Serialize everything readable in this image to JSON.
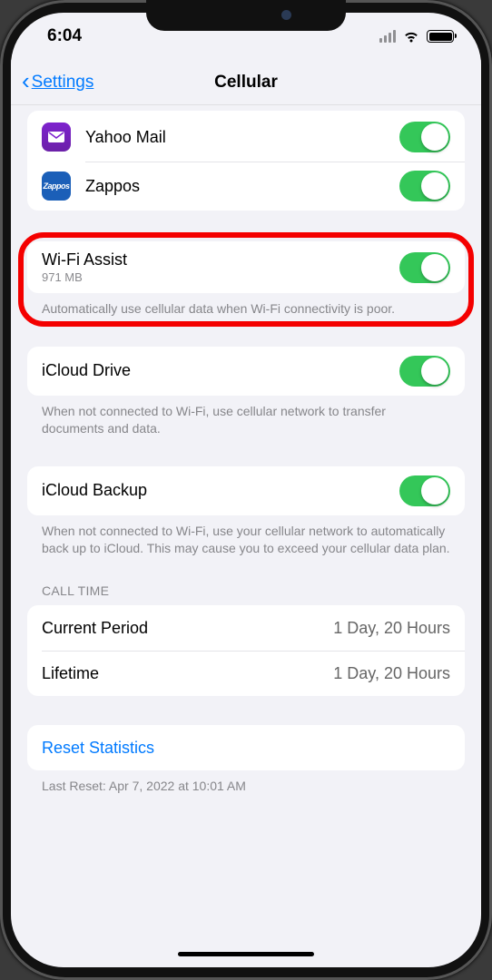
{
  "statusBar": {
    "time": "6:04"
  },
  "nav": {
    "back": "Settings",
    "title": "Cellular"
  },
  "apps": [
    {
      "name": "Yahoo Mail",
      "iconClass": "yahoo",
      "iconText": "✉",
      "toggleOn": true
    },
    {
      "name": "Zappos",
      "iconClass": "zappos",
      "iconText": "Zappos",
      "toggleOn": true
    }
  ],
  "wifiAssist": {
    "title": "Wi-Fi Assist",
    "subtitle": "971 MB",
    "footer": "Automatically use cellular data when Wi-Fi connectivity is poor.",
    "toggleOn": true
  },
  "icloudDrive": {
    "title": "iCloud Drive",
    "footer": "When not connected to Wi-Fi, use cellular network to transfer documents and data.",
    "toggleOn": true
  },
  "icloudBackup": {
    "title": "iCloud Backup",
    "footer": "When not connected to Wi-Fi, use your cellular network to automatically back up to iCloud. This may cause you to exceed your cellular data plan.",
    "toggleOn": true
  },
  "callTime": {
    "header": "CALL TIME",
    "rows": [
      {
        "label": "Current Period",
        "value": "1 Day, 20 Hours"
      },
      {
        "label": "Lifetime",
        "value": "1 Day, 20 Hours"
      }
    ]
  },
  "reset": {
    "label": "Reset Statistics",
    "lastReset": "Last Reset: Apr 7, 2022 at 10:01 AM"
  }
}
